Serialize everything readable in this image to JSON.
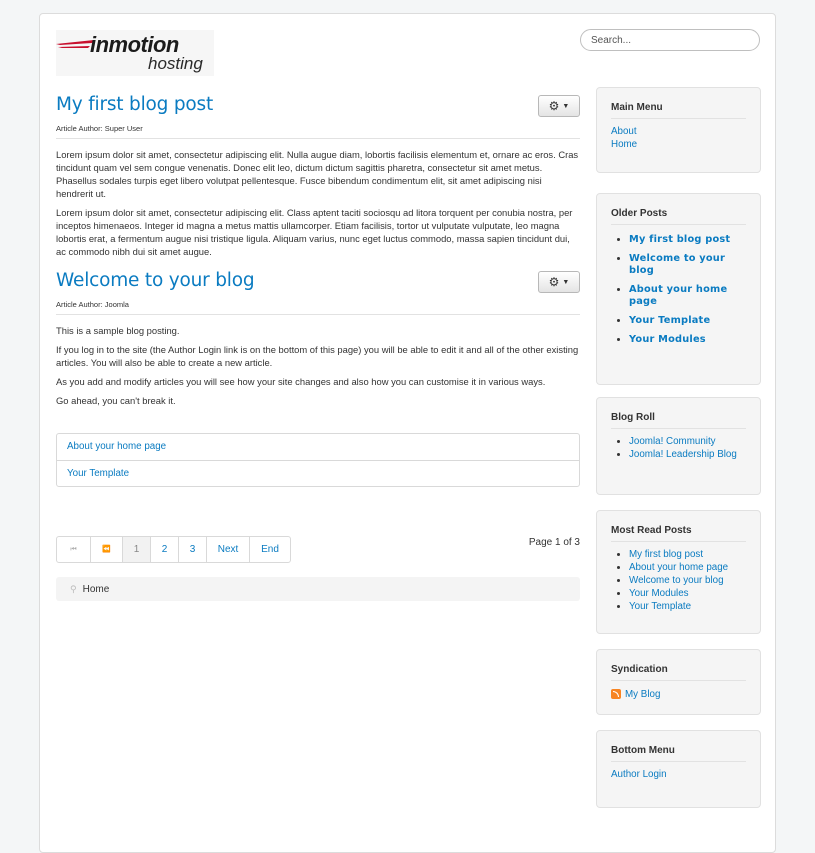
{
  "header": {
    "logo_word1": "inmotion",
    "logo_word2": "hosting",
    "search_placeholder": "Search..."
  },
  "articles": [
    {
      "title": "My first blog post",
      "author": "Article Author: Super User",
      "paragraphs": [
        "Lorem ipsum dolor sit amet, consectetur adipiscing elit. Nulla augue diam, lobortis facilisis elementum et, ornare ac eros. Cras tincidunt quam vel sem congue venenatis. Donec elit leo, dictum dictum sagittis pharetra, consectetur sit amet metus. Phasellus sodales turpis eget libero volutpat pellentesque. Fusce bibendum condimentum elit, sit amet adipiscing nisi hendrerit ut.",
        "Lorem ipsum dolor sit amet, consectetur adipiscing elit. Class aptent taciti sociosqu ad litora torquent per conubia nostra, per inceptos himenaeos. Integer id magna a metus mattis ullamcorper. Etiam facilisis, tortor ut vulputate vulputate, leo magna lobortis erat, a fermentum augue nisi tristique ligula. Aliquam varius, nunc eget luctus commodo, massa sapien tincidunt dui, ac commodo nibh dui sit amet augue."
      ]
    },
    {
      "title": "Welcome to your blog",
      "author": "Article Author: Joomla",
      "paragraphs": [
        "This is a sample blog posting.",
        "If you log in to the site (the Author Login link is on the bottom of this page) you will be able to edit it and all of the other existing articles. You will also be able to create a new article.",
        "As you add and modify articles you will see how your site changes and also how you can customise it in various ways.",
        "Go ahead, you can't break it."
      ]
    }
  ],
  "more_links": [
    "About your home page",
    "Your Template"
  ],
  "pagination": {
    "items": [
      "⏮",
      "⏪",
      "1",
      "2",
      "3",
      "Next",
      "End"
    ],
    "counter": "Page 1 of 3"
  },
  "breadcrumb": {
    "home": "Home"
  },
  "sidebar": {
    "main_menu": {
      "title": "Main Menu",
      "items": [
        "About",
        "Home"
      ]
    },
    "older_posts": {
      "title": "Older Posts",
      "items": [
        "My first blog post",
        "Welcome to your blog",
        "About your home page",
        "Your Template",
        "Your Modules"
      ]
    },
    "blog_roll": {
      "title": "Blog Roll",
      "items": [
        "Joomla! Community",
        "Joomla! Leadership Blog"
      ]
    },
    "most_read": {
      "title": "Most Read Posts",
      "items": [
        "My first blog post",
        "About your home page",
        "Welcome to your blog",
        "Your Modules",
        "Your Template"
      ]
    },
    "syndication": {
      "title": "Syndication",
      "link": "My Blog"
    },
    "bottom_menu": {
      "title": "Bottom Menu",
      "items": [
        "Author Login"
      ]
    }
  },
  "colors": {
    "link": "#0a7bc1",
    "rss": "#f78422",
    "logo_red": "#c8102e"
  }
}
